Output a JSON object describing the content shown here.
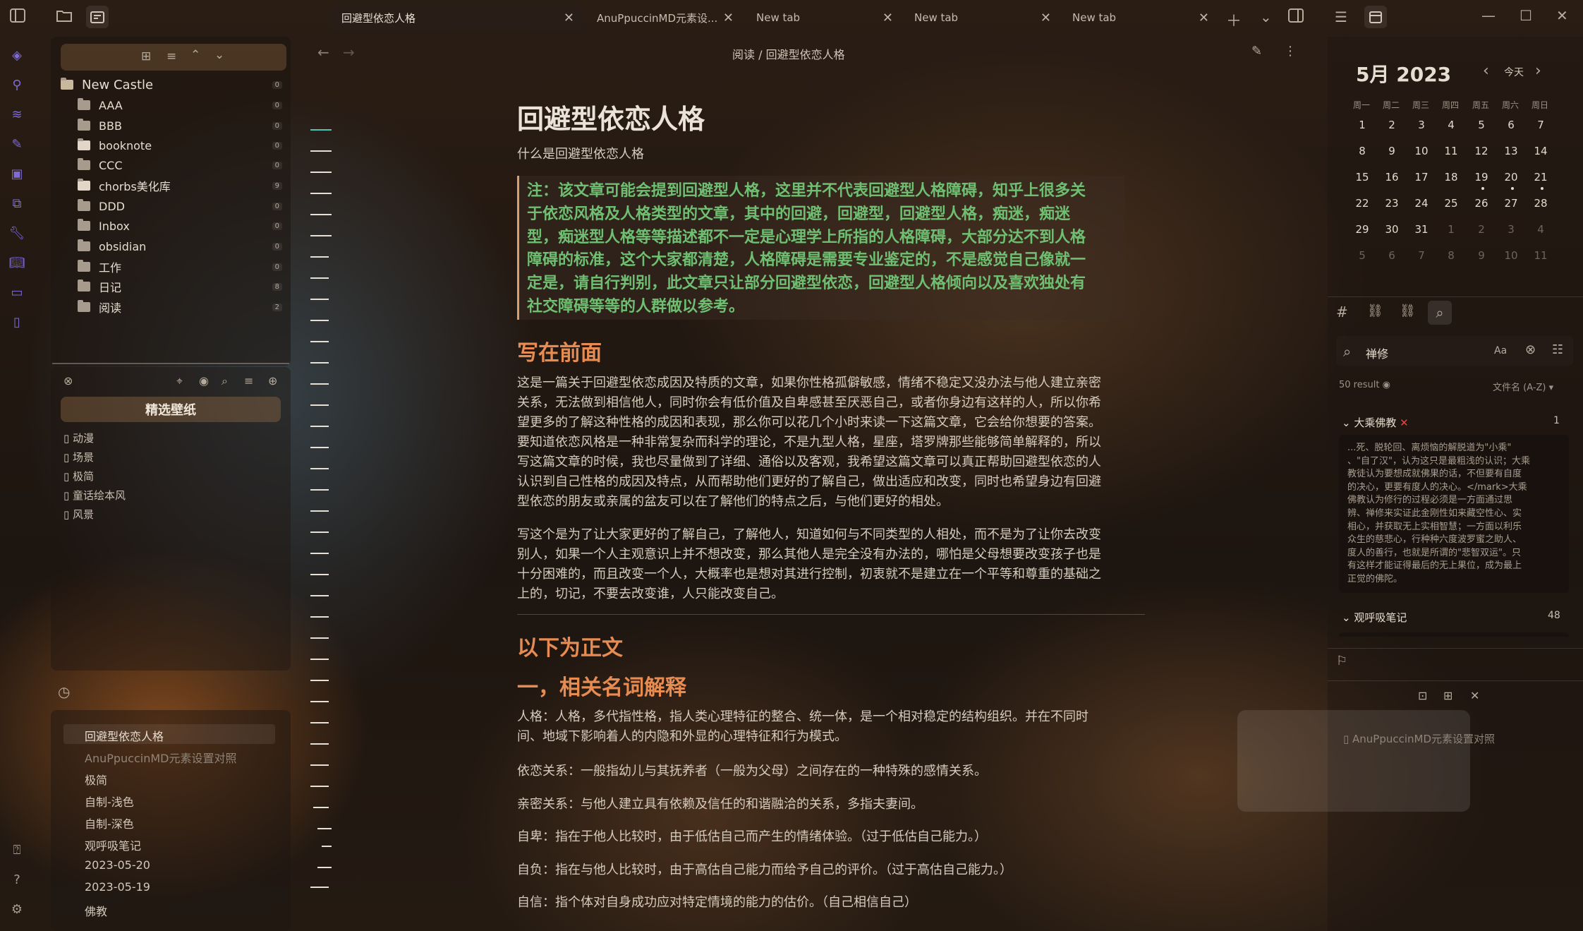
{
  "titlebar": {
    "tabs": [
      {
        "label": "回避型依恋人格",
        "active": true
      },
      {
        "label": "AnuPpuccinMD元素设..."
      },
      {
        "label": "New tab"
      },
      {
        "label": "New tab"
      },
      {
        "label": "New tab"
      }
    ]
  },
  "explorer": {
    "vault_name": "New Castle",
    "vault_count": "0",
    "folders": [
      {
        "name": "AAA",
        "count": "0"
      },
      {
        "name": "BBB",
        "count": "0"
      },
      {
        "name": "booknote",
        "count": "0"
      },
      {
        "name": "CCC",
        "count": "0"
      },
      {
        "name": "chorbs美化库",
        "count": "9"
      },
      {
        "name": "DDD",
        "count": "0"
      },
      {
        "name": "Inbox",
        "count": "0"
      },
      {
        "name": "obsidian",
        "count": "0"
      },
      {
        "name": "工作",
        "count": "0"
      },
      {
        "name": "日记",
        "count": "8"
      },
      {
        "name": "阅读",
        "count": "2"
      }
    ]
  },
  "gallery": {
    "title": "精选壁纸",
    "files": [
      "动漫",
      "场景",
      "极简",
      "童话绘本风",
      "风景"
    ]
  },
  "recent": {
    "items": [
      "回避型依恋人格",
      "AnuPpuccinMD元素设置对照",
      "极简",
      "自制-浅色",
      "自制-深色",
      "观呼吸笔记",
      "2023-05-20",
      "2023-05-19",
      "佛教"
    ]
  },
  "editor": {
    "breadcrumb": "阅读 / 回避型依恋人格",
    "title": "回避型依恋人格",
    "subtitle": "什么是回避型依恋人格",
    "callout_lines": [
      "注：该文章可能会提到回避型人格，这里并不代表回避型人格障碍，知乎上很多关",
      "于依恋风格及人格类型的文章，其中的回避，回避型，回避型人格，痴迷，痴迷",
      "型，痴迷型人格等等描述都不一定是心理学上所指的人格障碍，大部分达不到人格",
      "障碍的标准，这个大家都清楚，人格障碍是需要专业鉴定的，不是感觉自己像就一",
      "定是，请自行判别，此文章只让部分回避型依恋，回避型人格倾向以及喜欢独处有",
      "社交障碍等等的人群做以参考。"
    ],
    "heading_before": "写在前面",
    "para1_lines": [
      "这是一篇关于回避型依恋成因及特质的文章，如果你性格孤僻敏感，情绪不稳定又没办法与他人建立亲密",
      "关系，无法做到相信他人，同时你会有低价值及自卑感甚至厌恶自己，或者你身边有这样的人，所以你希",
      "望更多的了解这种性格的成因和表现，那么你可以花几个小时来读一下这篇文章，它会给你想要的答案。",
      "要知道依恋风格是一种非常复杂而科学的理论，不是九型人格，星座，塔罗牌那些能够简单解释的，所以",
      "写这篇文章的时候，我也尽量做到了详细、通俗以及客观，我希望这篇文章可以真正帮助回避型依恋的人",
      "认识到自己性格的成因及特点，从而帮助他们更好的了解自己，做出适应和改变，同时也希望身边有回避",
      "型依恋的朋友或亲属的盆友可以在了解他们的特点之后，与他们更好的相处。"
    ],
    "para2_lines": [
      "写这个是为了让大家更好的了解自己，了解他人，知道如何与不同类型的人相处，而不是为了让你去改变",
      "别人，如果一个人主观意识上并不想改变，那么其他人是完全没有办法的，哪怕是父母想要改变孩子也是",
      "十分困难的，而且改变一个人，大概率也是想对其进行控制，初衷就不是建立在一个平等和尊重的基础之",
      "上的，切记，不要去改变谁，人只能改变自己。"
    ],
    "heading_main": "以下为正文",
    "heading_terms": "一，相关名词解释",
    "term_person_lines": [
      "人格：人格，多代指性格，指人类心理特征的整合、统一体，是一个相对稳定的结构组织。并在不同时",
      "间、地域下影响着人的内隐和外显的心理特征和行为模式。"
    ],
    "term_attach": "依恋关系：一般指幼儿与其抚养者（一般为父母）之间存在的一种特殊的感情关系。",
    "term_intimate": "亲密关系：与他人建立具有依赖及信任的和谐融洽的关系，多指夫妻间。",
    "term_inferior": "自卑：指在于他人比较时，由于低估自己而产生的情绪体验。（过于低估自己能力。）",
    "term_conceit": "自负：指在与他人比较时，由于高估自己能力而给予自己的评价。（过于高估自己能力。）",
    "term_confidence": "自信：指个体对自身成功应对特定情境的能力的估价。（自己相信自己）"
  },
  "calendar": {
    "month_label": "5月 2023",
    "today_label": "今天",
    "weekdays": [
      "周一",
      "周二",
      "周三",
      "周四",
      "周五",
      "周六",
      "周日"
    ],
    "weeks": [
      [
        "1",
        "2",
        "3",
        "4",
        "5",
        "6",
        "7"
      ],
      [
        "8",
        "9",
        "10",
        "11",
        "12",
        "13",
        "14"
      ],
      [
        "15",
        "16",
        "17",
        "18",
        "19",
        "20",
        "21"
      ],
      [
        "22",
        "23",
        "24",
        "25",
        "26",
        "27",
        "28"
      ],
      [
        "29",
        "30",
        "31",
        "1",
        "2",
        "3",
        "4"
      ],
      [
        "5",
        "6",
        "7",
        "8",
        "9",
        "10",
        "11"
      ]
    ]
  },
  "search": {
    "query": "禅修",
    "match_case_label": "Aa",
    "result_count": "50 result",
    "sort_label": "文件名 (A-Z)",
    "group1_title": "大乘佛教",
    "group1_count": "1",
    "snippet_lines": [
      "...死、脱轮回、离烦恼的解脱道为\"小乘\"",
      "、\"自了汉\"，认为这只是最粗浅的认识；大乘",
      "教徒认为要想成就佛果的话，不但要有自度",
      "的决心，更要有度人的决心。</mark>大乘",
      "佛教认为修行的过程必须是一方面通过思",
      "辨、禅修来实证此金刚性如来藏空性心、实",
      "相心，并获取无上实相智慧；一方面以利乐",
      "众生的慈悲心，行种种六度波罗蜜之助人、",
      "度人的善行，也就是所谓的\"悲智双运\"。只",
      "有这样才能证得最后的无上果位，成为最上",
      "正觉的佛陀。"
    ],
    "group2_title": "观呼吸笔记",
    "group2_count": "48"
  },
  "bookmarks": {
    "item": "AnuPpuccinMD元素设置对照"
  }
}
